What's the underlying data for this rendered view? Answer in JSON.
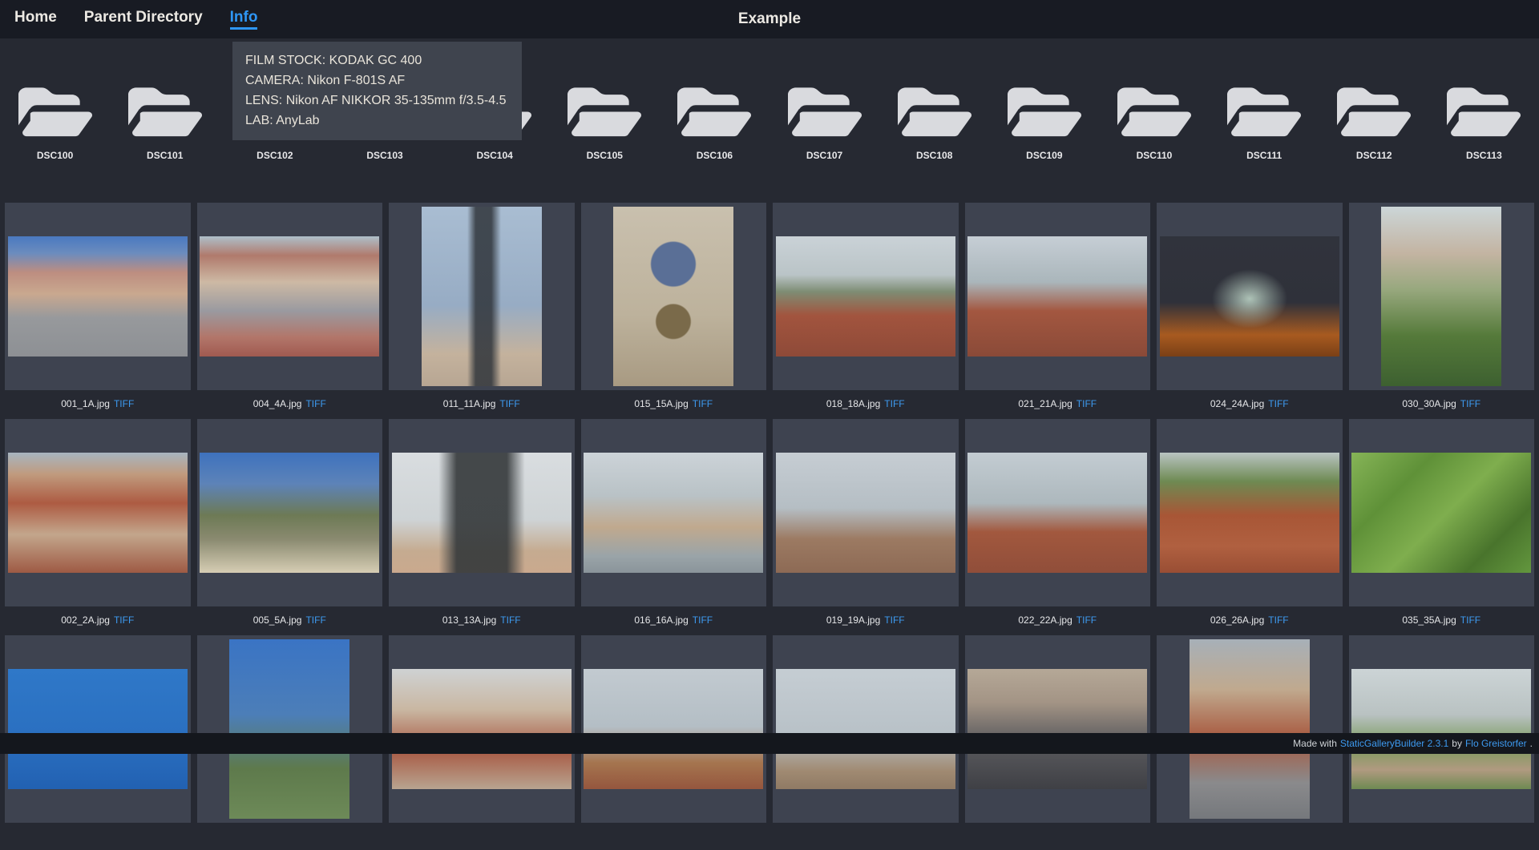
{
  "nav": {
    "items": [
      {
        "label": "Home"
      },
      {
        "label": "Parent Directory"
      },
      {
        "label": "Info",
        "active": true
      }
    ],
    "title": "Example"
  },
  "tooltip": {
    "lines": [
      "FILM STOCK: KODAK GC 400",
      "CAMERA: Nikon F-801S AF",
      "LENS: Nikon AF NIKKOR 35-135mm f/3.5-4.5",
      "LAB: AnyLab"
    ]
  },
  "folders": {
    "items": [
      "DSC100",
      "DSC101",
      "DSC102",
      "DSC103",
      "DSC104",
      "DSC105",
      "DSC106",
      "DSC107",
      "DSC108",
      "DSC109",
      "DSC110",
      "DSC111",
      "DSC112",
      "DSC113"
    ]
  },
  "gallery": {
    "tiff_label": "TIFF",
    "items": [
      {
        "name": "001_1A.jpg",
        "orientation": "landscape",
        "bg": "linear-gradient(180deg,#4a79c0 0%,#6b8cbe 14%,#bd8d80 30%,#c9a88f 48%,#97999c 68%,#8d9094 100%)"
      },
      {
        "name": "004_4A.jpg",
        "orientation": "landscape",
        "bg": "linear-gradient(180deg,#aebfca 0%,#b07a6c 16%,#cdb9a4 38%,#9a9aa0 62%,#b2766a 84%,#a05a50 100%)"
      },
      {
        "name": "011_11A.jpg",
        "orientation": "portrait",
        "bg": "linear-gradient(90deg,rgba(47,52,58,0) 38%,rgba(47,52,58,0.85) 45%,rgba(47,52,58,0.85) 58%,rgba(47,52,58,0) 66%),linear-gradient(180deg,#a9bdd2 0%,#97acc4 55%,#c4b29d 82%,#b7a693 100%)"
      },
      {
        "name": "015_15A.jpg",
        "orientation": "portrait",
        "bg": "radial-gradient(circle at 50% 32%,#5a6f96 0%,#5a6f96 16%,rgba(0,0,0,0) 17%),radial-gradient(circle at 50% 64%,#7a6a4a 0%,#7a6a4a 13%,rgba(0,0,0,0) 14%),linear-gradient(180deg,#c9c0ae 0%,#bdb29c 60%,#a89a82 100%)"
      },
      {
        "name": "018_18A.jpg",
        "orientation": "landscape",
        "bg": "linear-gradient(180deg,#cad2d7 0%,#bac4c7 32%,#7e8d74 46%,#a2543e 66%,#8e4a38 100%)"
      },
      {
        "name": "021_21A.jpg",
        "orientation": "landscape",
        "bg": "linear-gradient(180deg,#c6ced5 0%,#aab6bb 38%,#a35740 62%,#8a4a38 100%)"
      },
      {
        "name": "024_24A.jpg",
        "orientation": "landscape",
        "bg": "radial-gradient(ellipse 30% 35% at 50% 52%,rgba(196,220,205,0.85) 0%,rgba(196,220,205,0) 70%),linear-gradient(180deg,#30333c 0%,#2f313a 55%,#a85a20 82%,#7a4016 100%)"
      },
      {
        "name": "030_30A.jpg",
        "orientation": "portrait",
        "bg": "linear-gradient(180deg,#ccd6d8 0%,#c3b4a2 26%,#98a87e 46%,#557a3a 72%,#3d6030 100%)"
      },
      {
        "name": "002_2A.jpg",
        "orientation": "landscape",
        "bg": "linear-gradient(180deg,#a7b5c0 0%,#c09b7e 18%,#ad5b42 42%,#c3a68c 68%,#9e5a44 100%)"
      },
      {
        "name": "005_5A.jpg",
        "orientation": "landscape",
        "bg": "linear-gradient(180deg,#3e72be 0%,#5d83b8 26%,#6d7a55 52%,#8a8a70 72%,#d6cdb4 100%)"
      },
      {
        "name": "013_13A.jpg",
        "orientation": "landscape",
        "bg": "linear-gradient(90deg,rgba(52,56,58,0) 26%,rgba(52,56,58,0.9) 36%,rgba(52,56,58,0.9) 64%,rgba(52,56,58,0) 74%),linear-gradient(180deg,#d9dde0 0%,#ced3d5 56%,#c5ab90 82%,#caa98e 100%)"
      },
      {
        "name": "016_16A.jpg",
        "orientation": "landscape",
        "bg": "linear-gradient(180deg,#ccd3d8 0%,#b9c2c6 36%,#c0a98e 62%,#9aa4a8 86%,#8a949a 100%)"
      },
      {
        "name": "019_19A.jpg",
        "orientation": "landscape",
        "bg": "linear-gradient(180deg,#c6cdd3 0%,#b5bec4 46%,#9c7a62 72%,#8d6a55 100%)"
      },
      {
        "name": "022_22A.jpg",
        "orientation": "landscape",
        "bg": "linear-gradient(180deg,#c3ccd2 0%,#adb8bd 42%,#a2583e 66%,#904e3a 100%)"
      },
      {
        "name": "026_26A.jpg",
        "orientation": "landscape",
        "bg": "linear-gradient(180deg,#b9c4c2 0%,#6e8a52 24%,#a85636 52%,#b06040 78%,#994e34 100%)"
      },
      {
        "name": "035_35A.jpg",
        "orientation": "landscape",
        "bg": "linear-gradient(135deg,#86b457 0%,#5f9138 28%,#7fae4e 52%,#49742c 78%,#63973e 100%)"
      },
      {
        "orientation": "landscape",
        "bg": "linear-gradient(180deg,#2f78c8 0%,#2a6fc0 60%,#2261b2 100%)"
      },
      {
        "orientation": "portrait",
        "bg": "linear-gradient(180deg,#3a74c4 0%,#4c7eb8 42%,#5e7a4c 72%,#6d8a58 100%)"
      },
      {
        "orientation": "landscape",
        "bg": "linear-gradient(180deg,#cfd2d3 0%,#c9b7a2 34%,#a85a44 68%,#b8a490 100%)"
      },
      {
        "orientation": "landscape",
        "bg": "linear-gradient(180deg,#c2cad0 0%,#b4bec5 48%,#a5754f 78%,#95563e 100%)"
      },
      {
        "orientation": "landscape",
        "bg": "linear-gradient(180deg,#c5cdd3 0%,#b8c1c7 55%,#a08a72 85%,#8f7a64 100%)"
      },
      {
        "orientation": "landscape",
        "bg": "linear-gradient(180deg,#b5a897 0%,#a39485 28%,#5a5a5e 62%,#3f4045 100%)"
      },
      {
        "orientation": "portrait",
        "bg": "linear-gradient(180deg,#a7b0b8 0%,#c0a98e 28%,#a85a40 55%,#8a8a8c 80%,#75787c 100%)"
      },
      {
        "orientation": "landscape",
        "bg": "linear-gradient(180deg,#ccd4d6 0%,#b9c2c2 38%,#7a9a5c 64%,#b09a80 84%,#6e8a52 100%)"
      }
    ]
  },
  "footer": {
    "prefix": "Made with",
    "builder_link": "StaticGalleryBuilder 2.3.1",
    "connector": "by",
    "author_link": "Flo Greistorfer",
    "suffix": "."
  },
  "colors": {
    "page_bg": "#262932",
    "nav_bg": "#181b23",
    "card_bg": "#3e4350",
    "tooltip_bg": "#3f444e",
    "footer_bg": "#14171d",
    "accent_blue": "#2e96f5",
    "link_blue": "#3d9af0",
    "folder_icon": "#d9dade"
  }
}
